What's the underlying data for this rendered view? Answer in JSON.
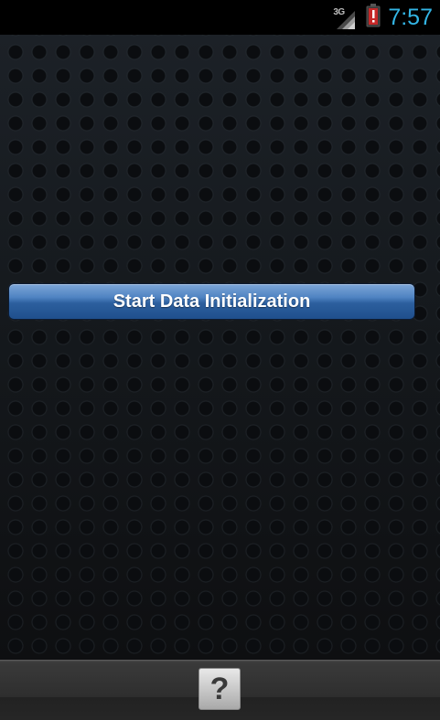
{
  "status_bar": {
    "network_type": "3G",
    "time": "7:57",
    "icons": [
      "signal-icon",
      "battery-alert-icon"
    ],
    "clock_color": "#33b5e5"
  },
  "notifications": {
    "icons": [
      "warning-icon"
    ]
  },
  "main": {
    "start_button_label": "Start Data Initialization"
  },
  "bottom_bar": {
    "help_button_label": "?"
  },
  "colors": {
    "button_blue": "#2c5f9e",
    "warning_red": "#d32f2f"
  }
}
